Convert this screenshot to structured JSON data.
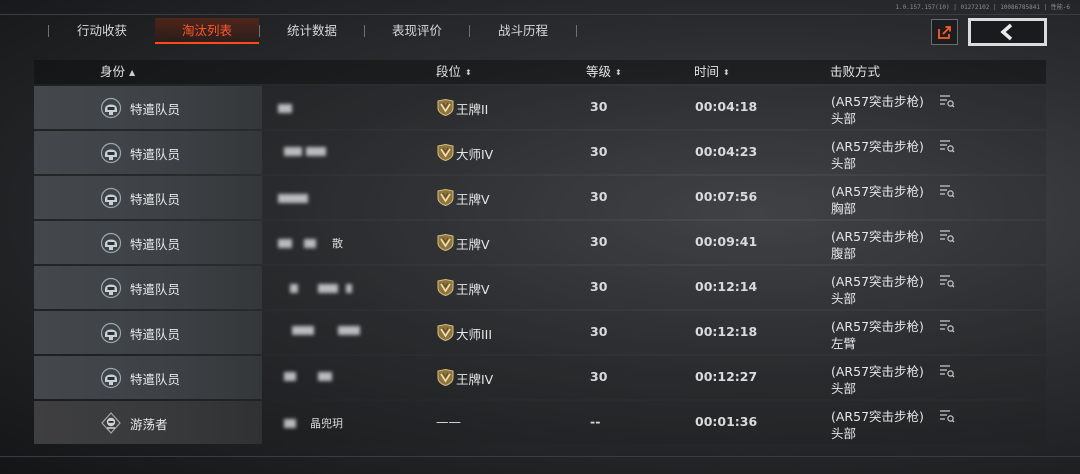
{
  "build_info": "1.0.157.157(10) | 01272102 | 10086785841 | 性能-6",
  "tabs": [
    {
      "label": "行动收获",
      "active": false
    },
    {
      "label": "淘汰列表",
      "active": true
    },
    {
      "label": "统计数据",
      "active": false
    },
    {
      "label": "表现评价",
      "active": false
    },
    {
      "label": "战斗历程",
      "active": false
    }
  ],
  "columns": {
    "identity": "身份",
    "rank": "段位",
    "level": "等级",
    "time": "时间",
    "kill_method": "击败方式"
  },
  "sort_glyphs": {
    "asc": "▲",
    "both": "⬍"
  },
  "colors": {
    "accent": "#ff4a1e",
    "text": "#e4e6e7",
    "row_identity": "#42464a"
  },
  "rows": [
    {
      "identity": "特遣队员",
      "icon": "operator-helmet-icon",
      "rank": "王牌II",
      "rank_icon": "rank-badge-icon",
      "level": "30",
      "time": "00:04:18",
      "weapon": "(AR57突击步枪)",
      "part": "头部",
      "name_visible": ""
    },
    {
      "identity": "特遣队员",
      "icon": "operator-helmet-icon",
      "rank": "大师IV",
      "rank_icon": "rank-badge-icon",
      "level": "30",
      "time": "00:04:23",
      "weapon": "(AR57突击步枪)",
      "part": "头部",
      "name_visible": ""
    },
    {
      "identity": "特遣队员",
      "icon": "operator-helmet-icon",
      "rank": "王牌V",
      "rank_icon": "rank-badge-icon",
      "level": "30",
      "time": "00:07:56",
      "weapon": "(AR57突击步枪)",
      "part": "胸部",
      "name_visible": ""
    },
    {
      "identity": "特遣队员",
      "icon": "operator-helmet-icon",
      "rank": "王牌V",
      "rank_icon": "rank-badge-icon",
      "level": "30",
      "time": "00:09:41",
      "weapon": "(AR57突击步枪)",
      "part": "腹部",
      "name_visible": "散"
    },
    {
      "identity": "特遣队员",
      "icon": "operator-helmet-icon",
      "rank": "王牌V",
      "rank_icon": "rank-badge-icon",
      "level": "30",
      "time": "00:12:14",
      "weapon": "(AR57突击步枪)",
      "part": "头部",
      "name_visible": ""
    },
    {
      "identity": "特遣队员",
      "icon": "operator-helmet-icon",
      "rank": "大师III",
      "rank_icon": "rank-badge-icon",
      "level": "30",
      "time": "00:12:18",
      "weapon": "(AR57突击步枪)",
      "part": "左臂",
      "name_visible": ""
    },
    {
      "identity": "特遣队员",
      "icon": "operator-helmet-icon",
      "rank": "王牌IV",
      "rank_icon": "rank-badge-icon",
      "level": "30",
      "time": "00:12:27",
      "weapon": "(AR57突击步枪)",
      "part": "头部",
      "name_visible": ""
    },
    {
      "identity": "游荡者",
      "icon": "wanderer-mask-icon",
      "rank": "——",
      "rank_icon": "",
      "level": "--",
      "time": "00:01:36",
      "weapon": "(AR57突击步枪)",
      "part": "头部",
      "name_visible": "晶兜玥"
    }
  ]
}
